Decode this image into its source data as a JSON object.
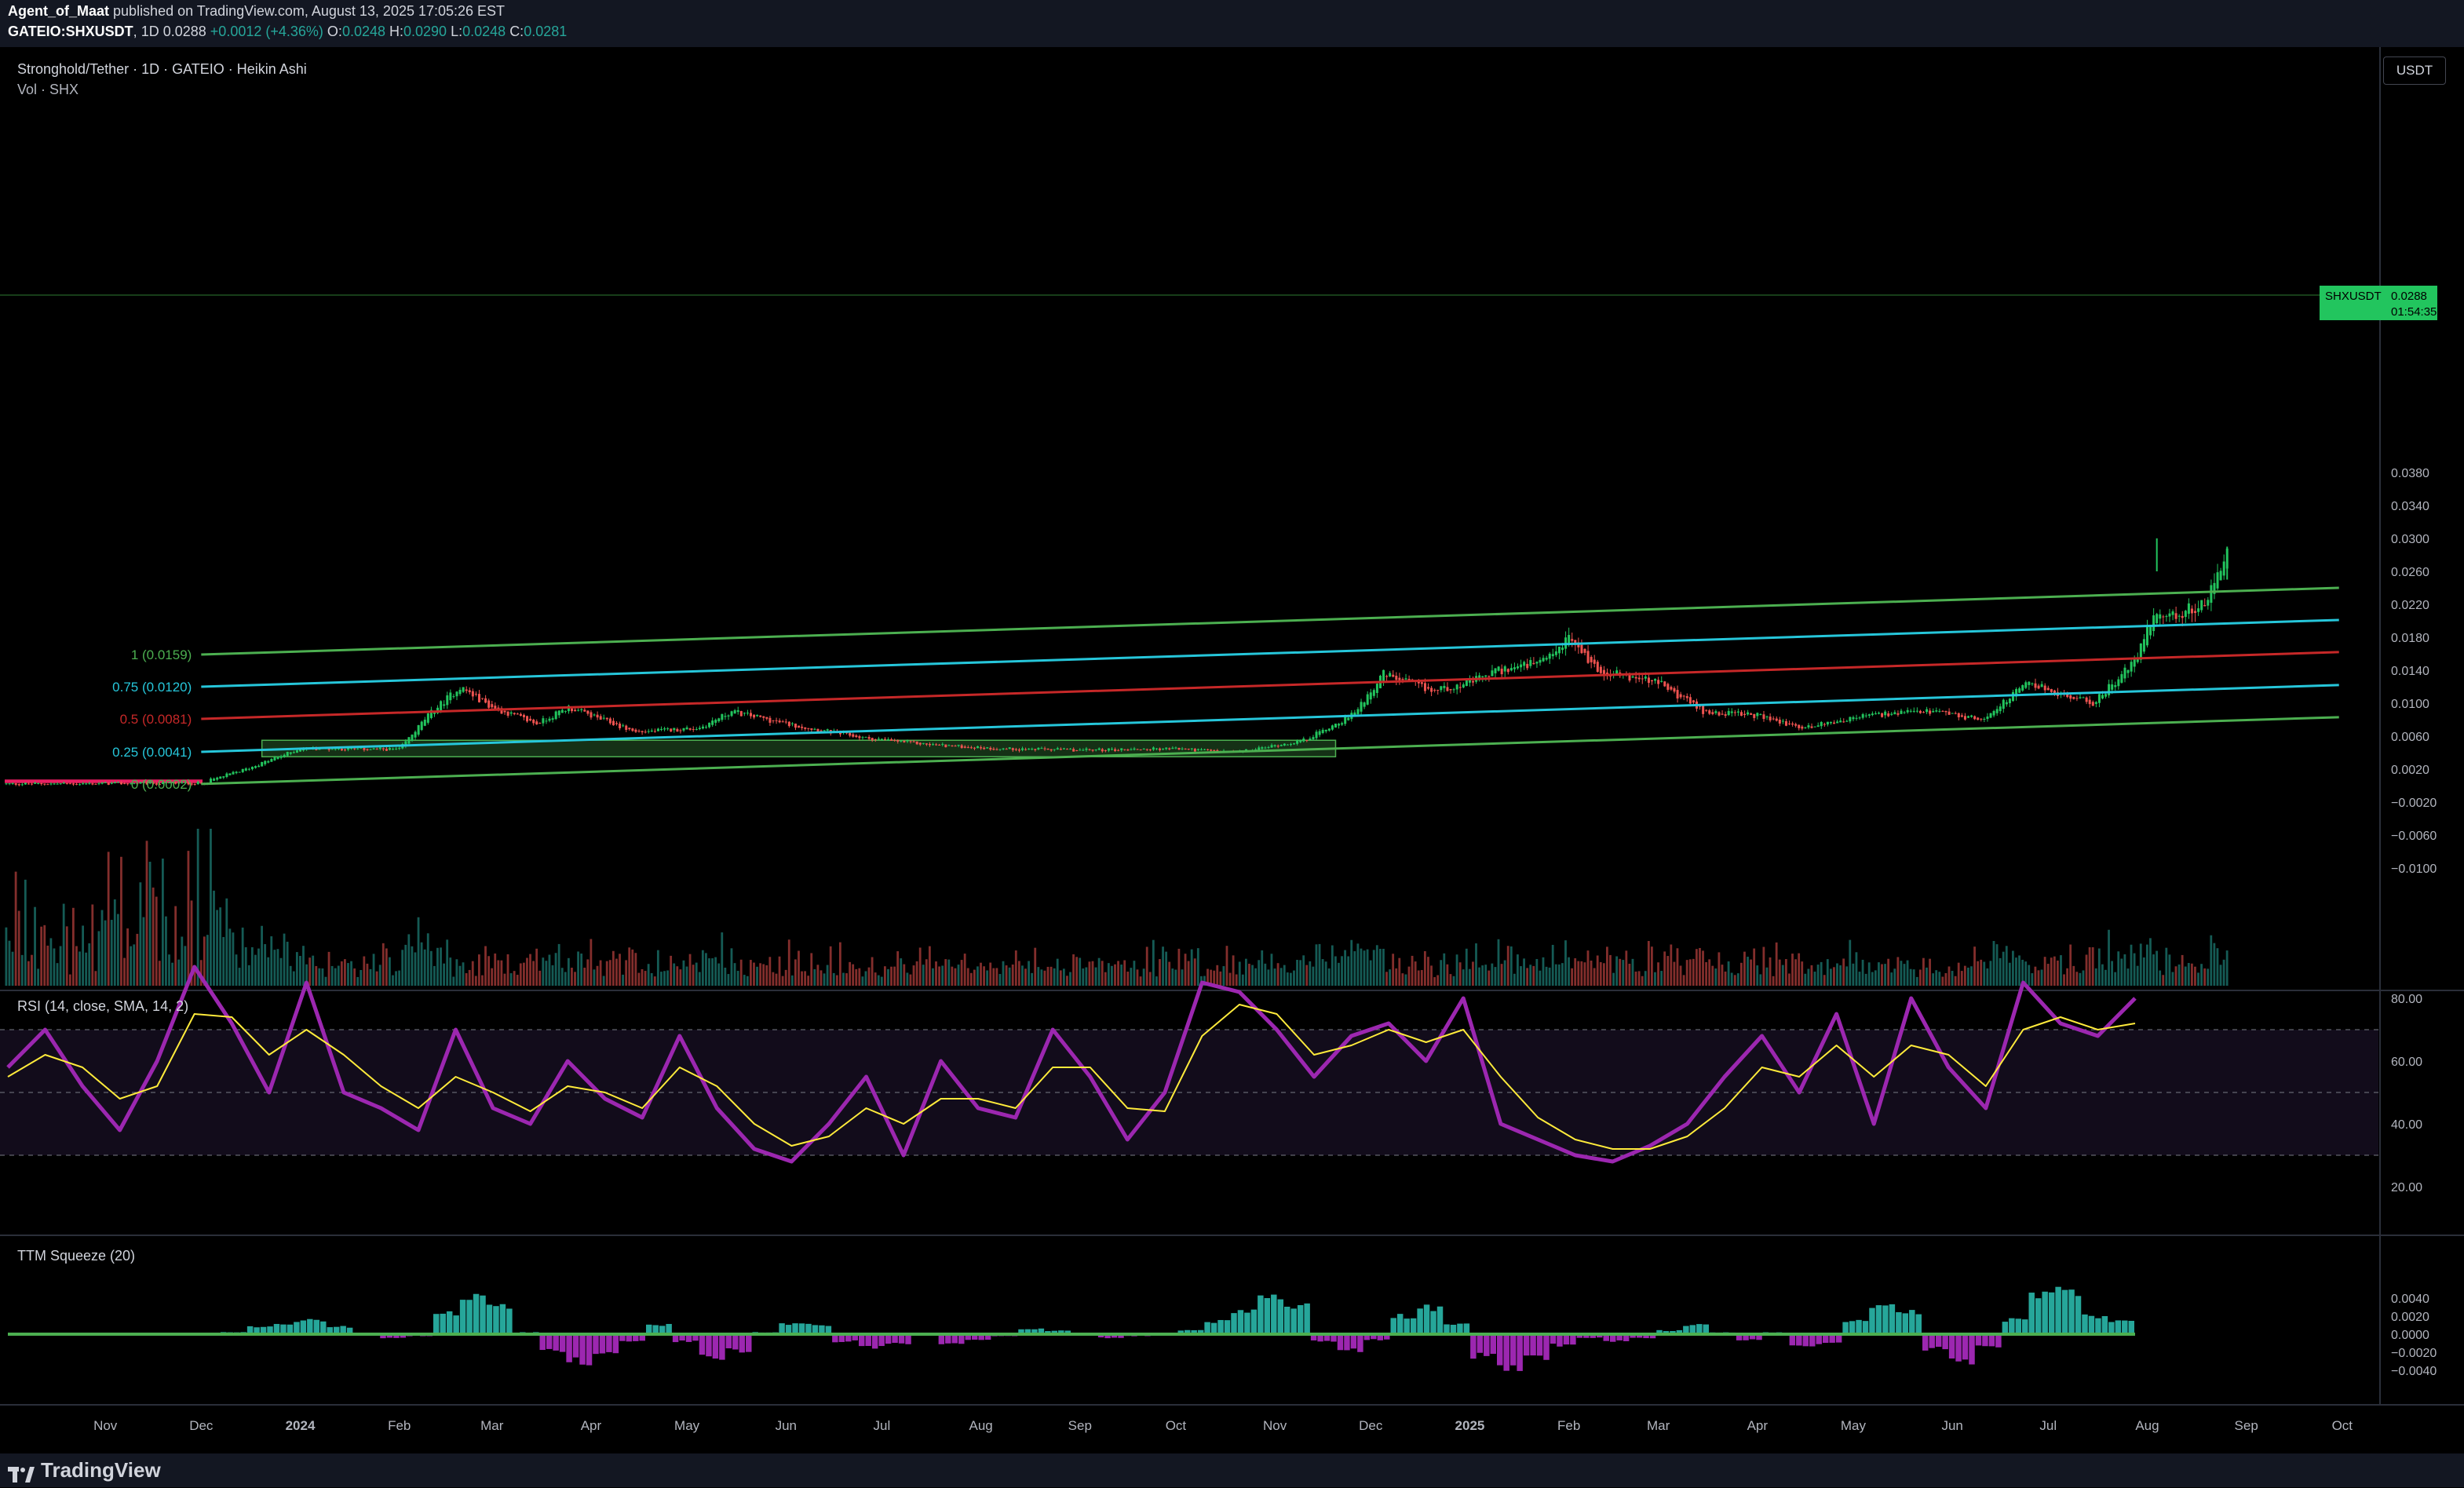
{
  "header": {
    "author": "Agent_of_Maat",
    "published": "published on TradingView.com, August 13, 2025 17:05:26 EST",
    "symbol": "GATEIO:SHXUSDT",
    "interval": "1D",
    "last": "0.0288",
    "change": "+0.0012 (+4.36%)",
    "o_label": "O:",
    "o": "0.0248",
    "h_label": "H:",
    "h": "0.0290",
    "l_label": "L:",
    "l": "0.0248",
    "c_label": "C:",
    "c": "0.0281"
  },
  "legend": {
    "title": "Stronghold/Tether · 1D · GATEIO · Heikin Ashi",
    "volume": "Vol · SHX",
    "rsi": "RSI (14, close, SMA, 14, 2)",
    "ttm": "TTM Squeeze (20)"
  },
  "currency_button": "USDT",
  "price_tag": {
    "symbol": "SHXUSDT",
    "value": "0.0288",
    "countdown": "01:54:35"
  },
  "footer": {
    "brand": "TradingView"
  },
  "colors": {
    "background": "#000000",
    "up": "#22c55e",
    "down": "#ef5350",
    "channel_outer": "#4caf50",
    "channel_quarter": "#26c6da",
    "channel_mid": "#c62828",
    "rsi_line": "#9c27b0",
    "rsi_signal": "#ffeb3b",
    "ttm_pos": "#26a69a",
    "ttm_neg": "#9c27b0"
  },
  "chart_data": [
    {
      "type": "candlestick",
      "title": "Stronghold/Tether · 1D · GATEIO · Heikin Ashi",
      "price_axis": [
        "0.0380",
        "0.0340",
        "0.0300",
        "0.0260",
        "0.0220",
        "0.0180",
        "0.0140",
        "0.0100",
        "0.0060",
        "0.0020",
        "−0.0020",
        "−0.0060",
        "−0.0100"
      ],
      "time_axis": [
        "Nov",
        "Dec",
        "2024",
        "Feb",
        "Mar",
        "Apr",
        "May",
        "Jun",
        "Jul",
        "Aug",
        "Sep",
        "Oct",
        "Nov",
        "Dec",
        "2025",
        "Feb",
        "Mar",
        "Apr",
        "May",
        "Jun",
        "Jul",
        "Aug",
        "Sep",
        "Oct"
      ],
      "fib_channel": [
        {
          "label": "1 (0.0159)",
          "start_price": 0.0159,
          "end_price": 0.024
        },
        {
          "label": "0.75 (0.0120)",
          "start_price": 0.012,
          "end_price": 0.0201
        },
        {
          "label": "0.5 (0.0081)",
          "start_price": 0.0081,
          "end_price": 0.0162
        },
        {
          "label": "0.25 (0.0041)",
          "start_price": 0.0041,
          "end_price": 0.0122
        },
        {
          "label": "0 (0.0002)",
          "start_price": 0.0002,
          "end_price": 0.0083
        }
      ],
      "channel_time_range": [
        "2023-12-01",
        "2025-09-30"
      ],
      "accumulation_zone": {
        "from_date": "2023-12-20",
        "to_date": "2024-11-20",
        "low": 0.0035,
        "high": 0.0055
      },
      "price_path": [
        [
          "2023-10-01",
          0.0002
        ],
        [
          "2023-12-01",
          0.0003
        ],
        [
          "2023-12-15",
          0.002
        ],
        [
          "2024-01-01",
          0.0045
        ],
        [
          "2024-02-01",
          0.0044
        ],
        [
          "2024-02-10",
          0.0085
        ],
        [
          "2024-02-20",
          0.012
        ],
        [
          "2024-03-01",
          0.0095
        ],
        [
          "2024-03-15",
          0.0075
        ],
        [
          "2024-03-25",
          0.0095
        ],
        [
          "2024-04-15",
          0.0065
        ],
        [
          "2024-05-05",
          0.007
        ],
        [
          "2024-05-15",
          0.009
        ],
        [
          "2024-06-01",
          0.0075
        ],
        [
          "2024-06-25",
          0.0058
        ],
        [
          "2024-07-15",
          0.005
        ],
        [
          "2024-08-05",
          0.0045
        ],
        [
          "2024-09-01",
          0.0043
        ],
        [
          "2024-10-01",
          0.0045
        ],
        [
          "2024-10-20",
          0.004
        ],
        [
          "2024-11-10",
          0.0055
        ],
        [
          "2024-11-25",
          0.0085
        ],
        [
          "2024-12-05",
          0.0135
        ],
        [
          "2024-12-20",
          0.0115
        ],
        [
          "2025-01-01",
          0.0125
        ],
        [
          "2025-01-10",
          0.014
        ],
        [
          "2025-01-25",
          0.015
        ],
        [
          "2025-02-01",
          0.018
        ],
        [
          "2025-02-10",
          0.014
        ],
        [
          "2025-03-01",
          0.0125
        ],
        [
          "2025-03-15",
          0.009
        ],
        [
          "2025-04-01",
          0.0085
        ],
        [
          "2025-04-15",
          0.007
        ],
        [
          "2025-05-05",
          0.0085
        ],
        [
          "2025-05-25",
          0.009
        ],
        [
          "2025-06-10",
          0.008
        ],
        [
          "2025-06-25",
          0.0125
        ],
        [
          "2025-07-05",
          0.011
        ],
        [
          "2025-07-15",
          0.01
        ],
        [
          "2025-07-28",
          0.015
        ],
        [
          "2025-08-03",
          0.021
        ],
        [
          "2025-08-10",
          0.0205
        ],
        [
          "2025-08-20",
          0.0225
        ],
        [
          "2025-08-26",
          0.028
        ]
      ],
      "spike_highs": [
        [
          "2025-08-04",
          0.03
        ],
        [
          "2025-08-26",
          0.029
        ]
      ],
      "last_price": 0.0288
    },
    {
      "type": "bar",
      "title": "Vol · SHX",
      "note": "daily volume histogram colored by candle direction; spikes at Dec 2023 and Aug 2025"
    },
    {
      "type": "line",
      "title": "RSI (14, close, SMA, 14, 2)",
      "y_ticks": [
        "80.00",
        "60.00",
        "40.00",
        "20.00"
      ],
      "bands": [
        30,
        50,
        70
      ],
      "series": [
        {
          "name": "RSI",
          "values": [
            58,
            70,
            52,
            38,
            60,
            90,
            72,
            50,
            85,
            50,
            45,
            38,
            70,
            45,
            40,
            60,
            48,
            42,
            68,
            45,
            32,
            28,
            40,
            55,
            30,
            60,
            45,
            42,
            70,
            55,
            35,
            50,
            85,
            82,
            70,
            55,
            68,
            72,
            60,
            80,
            40,
            35,
            30,
            28,
            33,
            40,
            55,
            68,
            50,
            75,
            40,
            80,
            58,
            45,
            85,
            72,
            68,
            80
          ]
        },
        {
          "name": "Signal",
          "values": [
            55,
            62,
            58,
            48,
            52,
            75,
            74,
            62,
            70,
            62,
            52,
            45,
            55,
            50,
            44,
            52,
            50,
            45,
            58,
            52,
            40,
            33,
            36,
            45,
            40,
            48,
            48,
            45,
            58,
            58,
            45,
            44,
            68,
            78,
            75,
            62,
            65,
            70,
            66,
            70,
            55,
            42,
            35,
            32,
            32,
            36,
            45,
            58,
            55,
            65,
            55,
            65,
            62,
            52,
            70,
            74,
            70,
            72
          ]
        }
      ]
    },
    {
      "type": "bar",
      "title": "TTM Squeeze (20)",
      "y_ticks": [
        "0.0040",
        "0.0020",
        "0.0000",
        "−0.0020",
        "−0.0040"
      ],
      "values": [
        0,
        0,
        0,
        0,
        0,
        0,
        0,
        0,
        0.0002,
        0.0008,
        0.0012,
        0.0016,
        0.0008,
        0.0,
        -0.0004,
        -0.0002,
        0.0024,
        0.0044,
        0.003,
        0.0002,
        -0.0018,
        -0.003,
        -0.002,
        -0.0008,
        0.001,
        -0.0008,
        -0.0026,
        -0.0018,
        0.0002,
        0.0012,
        0.001,
        -0.0008,
        -0.0014,
        -0.001,
        0.0,
        -0.001,
        -0.0006,
        -0.0002,
        0.0006,
        0.0004,
        0.0,
        -0.0004,
        -0.0002,
        0.0,
        0.0004,
        0.0014,
        0.0026,
        0.004,
        0.003,
        -0.0008,
        -0.0018,
        -0.0006,
        0.002,
        0.003,
        0.0012,
        -0.0024,
        -0.0036,
        -0.0026,
        -0.0012,
        -0.0004,
        -0.0008,
        -0.0004,
        0.0004,
        0.001,
        0.0002,
        -0.0006,
        0.0002,
        -0.0014,
        -0.001,
        0.0014,
        0.003,
        0.0026,
        -0.0016,
        -0.003,
        -0.0014,
        0.0016,
        0.0044,
        0.0048,
        0.002,
        0.0014
      ]
    }
  ]
}
